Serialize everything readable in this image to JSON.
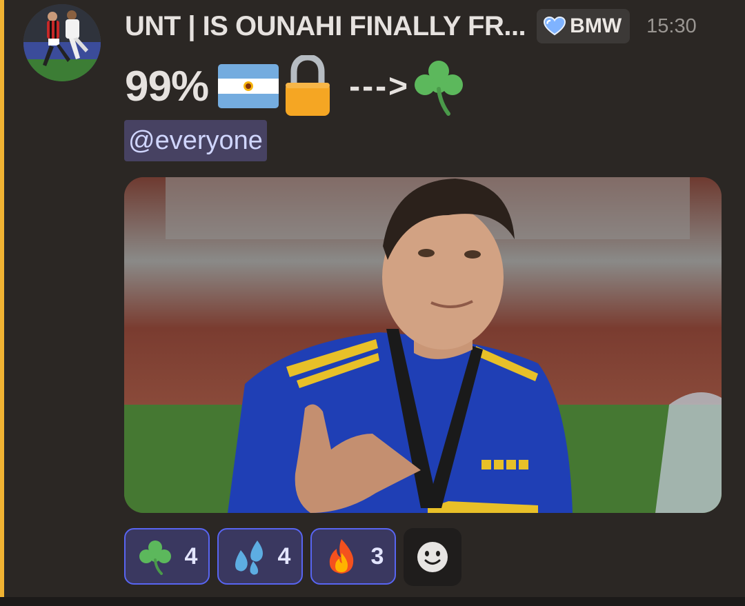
{
  "message": {
    "author": "UNT | IS OUNAHI FINALLY FR...",
    "role_tag": {
      "name": "BMW",
      "icon": "heart-icon",
      "color": "#7fb3ff"
    },
    "timestamp": "15:30",
    "content": {
      "percent_text": "99%",
      "emojis": [
        "argentina-flag-icon",
        "lock-icon",
        "shamrock-icon"
      ],
      "arrow_text": "--->",
      "mention": "@everyone"
    },
    "attachment": {
      "type": "image",
      "subject": "player-photo"
    }
  },
  "reactions": [
    {
      "emoji": "shamrock-icon",
      "count": "4"
    },
    {
      "emoji": "sweat-droplets-icon",
      "count": "4"
    },
    {
      "emoji": "fire-icon",
      "count": "3"
    }
  ],
  "add_reaction": {
    "icon": "smiley-icon"
  },
  "colors": {
    "background": "#2b2724",
    "accent_bar": "#f0b232",
    "mention_bg": "#474262",
    "reaction_border": "#5865f2"
  }
}
